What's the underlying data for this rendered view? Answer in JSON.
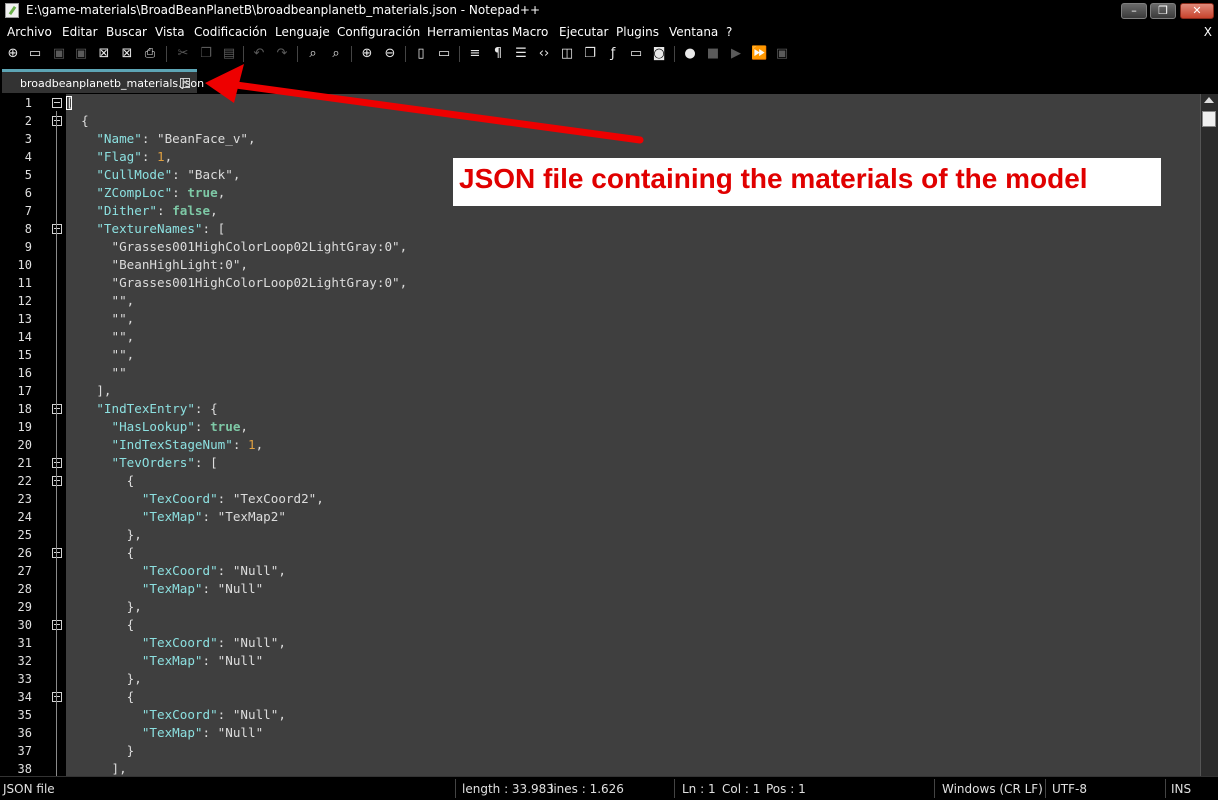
{
  "window": {
    "title": "E:\\game-materials\\BroadBeanPlanetB\\broadbeanplanetb_materials.json - Notepad++",
    "min_glyph": "–",
    "max_glyph": "❐",
    "close_glyph": "✕"
  },
  "menu": {
    "items": [
      "Archivo",
      "Editar",
      "Buscar",
      "Vista",
      "Codificación",
      "Lenguaje",
      "Configuración",
      "Herramientas",
      "Macro",
      "Ejecutar",
      "Plugins",
      "Ventana",
      "?"
    ],
    "close_label": "X"
  },
  "toolbar": {
    "icons": [
      "new-file-icon",
      "open-file-icon",
      "save-icon",
      "save-all-icon",
      "close-icon",
      "close-all-icon",
      "print-icon",
      "cut-icon",
      "copy-icon",
      "paste-icon",
      "undo-icon",
      "redo-icon",
      "find-icon",
      "replace-icon",
      "zoom-in-icon",
      "zoom-out-icon",
      "sync-vertical-icon",
      "sync-horizontal-icon",
      "word-wrap-icon",
      "show-all-chars-icon",
      "indent-guide-icon",
      "xml-tag-icon",
      "document-map-icon",
      "function-list-icon",
      "function-icon",
      "monitor-icon",
      "screenshot-icon",
      "record-macro-icon",
      "stop-macro-icon",
      "play-macro-icon",
      "run-macro-multiple-icon",
      "save-macro-icon"
    ]
  },
  "tab": {
    "label": "broadbeanplanetb_materials.json",
    "close_glyph": "×",
    "accent": "#5da5b5"
  },
  "editor": {
    "colors": {
      "background": "#3f3f3f",
      "key": "#8ce0e0",
      "number": "#e0a040",
      "boolean": "#7ec9a6"
    },
    "lines": [
      {
        "n": "1",
        "fold": true,
        "t": [
          [
            "p",
            "["
          ]
        ]
      },
      {
        "n": "2",
        "fold": true,
        "t": [
          [
            "p",
            "  {"
          ]
        ]
      },
      {
        "n": "3",
        "t": [
          [
            "p",
            "    "
          ],
          [
            "k",
            "\"Name\""
          ],
          [
            "p",
            ": "
          ],
          [
            "s",
            "\"BeanFace_v\""
          ],
          [
            "p",
            ","
          ]
        ]
      },
      {
        "n": "4",
        "t": [
          [
            "p",
            "    "
          ],
          [
            "k",
            "\"Flag\""
          ],
          [
            "p",
            ": "
          ],
          [
            "n",
            "1"
          ],
          [
            "p",
            ","
          ]
        ]
      },
      {
        "n": "5",
        "t": [
          [
            "p",
            "    "
          ],
          [
            "k",
            "\"CullMode\""
          ],
          [
            "p",
            ": "
          ],
          [
            "s",
            "\"Back\""
          ],
          [
            "p",
            ","
          ]
        ]
      },
      {
        "n": "6",
        "t": [
          [
            "p",
            "    "
          ],
          [
            "k",
            "\"ZCompLoc\""
          ],
          [
            "p",
            ": "
          ],
          [
            "b",
            "true"
          ],
          [
            "p",
            ","
          ]
        ]
      },
      {
        "n": "7",
        "t": [
          [
            "p",
            "    "
          ],
          [
            "k",
            "\"Dither\""
          ],
          [
            "p",
            ": "
          ],
          [
            "b",
            "false"
          ],
          [
            "p",
            ","
          ]
        ]
      },
      {
        "n": "8",
        "fold": true,
        "t": [
          [
            "p",
            "    "
          ],
          [
            "k",
            "\"TextureNames\""
          ],
          [
            "p",
            ": ["
          ]
        ]
      },
      {
        "n": "9",
        "t": [
          [
            "p",
            "      "
          ],
          [
            "s",
            "\"Grasses001HighColorLoop02LightGray:0\""
          ],
          [
            "p",
            ","
          ]
        ]
      },
      {
        "n": "10",
        "t": [
          [
            "p",
            "      "
          ],
          [
            "s",
            "\"BeanHighLight:0\""
          ],
          [
            "p",
            ","
          ]
        ]
      },
      {
        "n": "11",
        "t": [
          [
            "p",
            "      "
          ],
          [
            "s",
            "\"Grasses001HighColorLoop02LightGray:0\""
          ],
          [
            "p",
            ","
          ]
        ]
      },
      {
        "n": "12",
        "t": [
          [
            "p",
            "      "
          ],
          [
            "s",
            "\"\""
          ],
          [
            "p",
            ","
          ]
        ]
      },
      {
        "n": "13",
        "t": [
          [
            "p",
            "      "
          ],
          [
            "s",
            "\"\""
          ],
          [
            "p",
            ","
          ]
        ]
      },
      {
        "n": "14",
        "t": [
          [
            "p",
            "      "
          ],
          [
            "s",
            "\"\""
          ],
          [
            "p",
            ","
          ]
        ]
      },
      {
        "n": "15",
        "t": [
          [
            "p",
            "      "
          ],
          [
            "s",
            "\"\""
          ],
          [
            "p",
            ","
          ]
        ]
      },
      {
        "n": "16",
        "t": [
          [
            "p",
            "      "
          ],
          [
            "s",
            "\"\""
          ]
        ]
      },
      {
        "n": "17",
        "t": [
          [
            "p",
            "    ],"
          ]
        ]
      },
      {
        "n": "18",
        "fold": true,
        "t": [
          [
            "p",
            "    "
          ],
          [
            "k",
            "\"IndTexEntry\""
          ],
          [
            "p",
            ": {"
          ]
        ]
      },
      {
        "n": "19",
        "t": [
          [
            "p",
            "      "
          ],
          [
            "k",
            "\"HasLookup\""
          ],
          [
            "p",
            ": "
          ],
          [
            "b",
            "true"
          ],
          [
            "p",
            ","
          ]
        ]
      },
      {
        "n": "20",
        "t": [
          [
            "p",
            "      "
          ],
          [
            "k",
            "\"IndTexStageNum\""
          ],
          [
            "p",
            ": "
          ],
          [
            "n",
            "1"
          ],
          [
            "p",
            ","
          ]
        ]
      },
      {
        "n": "21",
        "fold": true,
        "t": [
          [
            "p",
            "      "
          ],
          [
            "k",
            "\"TevOrders\""
          ],
          [
            "p",
            ": ["
          ]
        ]
      },
      {
        "n": "22",
        "fold": true,
        "t": [
          [
            "p",
            "        {"
          ]
        ]
      },
      {
        "n": "23",
        "t": [
          [
            "p",
            "          "
          ],
          [
            "k",
            "\"TexCoord\""
          ],
          [
            "p",
            ": "
          ],
          [
            "s",
            "\"TexCoord2\""
          ],
          [
            "p",
            ","
          ]
        ]
      },
      {
        "n": "24",
        "t": [
          [
            "p",
            "          "
          ],
          [
            "k",
            "\"TexMap\""
          ],
          [
            "p",
            ": "
          ],
          [
            "s",
            "\"TexMap2\""
          ]
        ]
      },
      {
        "n": "25",
        "t": [
          [
            "p",
            "        },"
          ]
        ]
      },
      {
        "n": "26",
        "fold": true,
        "t": [
          [
            "p",
            "        {"
          ]
        ]
      },
      {
        "n": "27",
        "t": [
          [
            "p",
            "          "
          ],
          [
            "k",
            "\"TexCoord\""
          ],
          [
            "p",
            ": "
          ],
          [
            "s",
            "\"Null\""
          ],
          [
            "p",
            ","
          ]
        ]
      },
      {
        "n": "28",
        "t": [
          [
            "p",
            "          "
          ],
          [
            "k",
            "\"TexMap\""
          ],
          [
            "p",
            ": "
          ],
          [
            "s",
            "\"Null\""
          ]
        ]
      },
      {
        "n": "29",
        "t": [
          [
            "p",
            "        },"
          ]
        ]
      },
      {
        "n": "30",
        "fold": true,
        "t": [
          [
            "p",
            "        {"
          ]
        ]
      },
      {
        "n": "31",
        "t": [
          [
            "p",
            "          "
          ],
          [
            "k",
            "\"TexCoord\""
          ],
          [
            "p",
            ": "
          ],
          [
            "s",
            "\"Null\""
          ],
          [
            "p",
            ","
          ]
        ]
      },
      {
        "n": "32",
        "t": [
          [
            "p",
            "          "
          ],
          [
            "k",
            "\"TexMap\""
          ],
          [
            "p",
            ": "
          ],
          [
            "s",
            "\"Null\""
          ]
        ]
      },
      {
        "n": "33",
        "t": [
          [
            "p",
            "        },"
          ]
        ]
      },
      {
        "n": "34",
        "fold": true,
        "t": [
          [
            "p",
            "        {"
          ]
        ]
      },
      {
        "n": "35",
        "t": [
          [
            "p",
            "          "
          ],
          [
            "k",
            "\"TexCoord\""
          ],
          [
            "p",
            ": "
          ],
          [
            "s",
            "\"Null\""
          ],
          [
            "p",
            ","
          ]
        ]
      },
      {
        "n": "36",
        "t": [
          [
            "p",
            "          "
          ],
          [
            "k",
            "\"TexMap\""
          ],
          [
            "p",
            ": "
          ],
          [
            "s",
            "\"Null\""
          ]
        ]
      },
      {
        "n": "37",
        "t": [
          [
            "p",
            "        }"
          ]
        ]
      },
      {
        "n": "38",
        "t": [
          [
            "p",
            "      ],"
          ]
        ]
      }
    ]
  },
  "annotation": {
    "text": "JSON file containing the materials of the model",
    "color": "#e00000"
  },
  "status": {
    "file_type": "JSON file",
    "length": "length : 33.983",
    "lines": "lines : 1.626",
    "ln": "Ln : 1",
    "col": "Col : 1",
    "pos": "Pos : 1",
    "eol": "Windows (CR LF)",
    "encoding": "UTF-8",
    "mode": "INS"
  }
}
